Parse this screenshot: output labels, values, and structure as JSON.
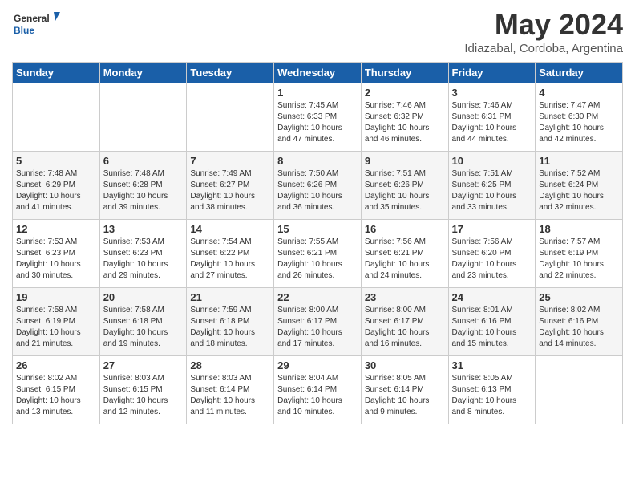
{
  "header": {
    "logo_general": "General",
    "logo_blue": "Blue",
    "title": "May 2024",
    "location": "Idiazabal, Cordoba, Argentina"
  },
  "days_of_week": [
    "Sunday",
    "Monday",
    "Tuesday",
    "Wednesday",
    "Thursday",
    "Friday",
    "Saturday"
  ],
  "weeks": [
    [
      {
        "day": "",
        "info": ""
      },
      {
        "day": "",
        "info": ""
      },
      {
        "day": "",
        "info": ""
      },
      {
        "day": "1",
        "info": "Sunrise: 7:45 AM\nSunset: 6:33 PM\nDaylight: 10 hours\nand 47 minutes."
      },
      {
        "day": "2",
        "info": "Sunrise: 7:46 AM\nSunset: 6:32 PM\nDaylight: 10 hours\nand 46 minutes."
      },
      {
        "day": "3",
        "info": "Sunrise: 7:46 AM\nSunset: 6:31 PM\nDaylight: 10 hours\nand 44 minutes."
      },
      {
        "day": "4",
        "info": "Sunrise: 7:47 AM\nSunset: 6:30 PM\nDaylight: 10 hours\nand 42 minutes."
      }
    ],
    [
      {
        "day": "5",
        "info": "Sunrise: 7:48 AM\nSunset: 6:29 PM\nDaylight: 10 hours\nand 41 minutes."
      },
      {
        "day": "6",
        "info": "Sunrise: 7:48 AM\nSunset: 6:28 PM\nDaylight: 10 hours\nand 39 minutes."
      },
      {
        "day": "7",
        "info": "Sunrise: 7:49 AM\nSunset: 6:27 PM\nDaylight: 10 hours\nand 38 minutes."
      },
      {
        "day": "8",
        "info": "Sunrise: 7:50 AM\nSunset: 6:26 PM\nDaylight: 10 hours\nand 36 minutes."
      },
      {
        "day": "9",
        "info": "Sunrise: 7:51 AM\nSunset: 6:26 PM\nDaylight: 10 hours\nand 35 minutes."
      },
      {
        "day": "10",
        "info": "Sunrise: 7:51 AM\nSunset: 6:25 PM\nDaylight: 10 hours\nand 33 minutes."
      },
      {
        "day": "11",
        "info": "Sunrise: 7:52 AM\nSunset: 6:24 PM\nDaylight: 10 hours\nand 32 minutes."
      }
    ],
    [
      {
        "day": "12",
        "info": "Sunrise: 7:53 AM\nSunset: 6:23 PM\nDaylight: 10 hours\nand 30 minutes."
      },
      {
        "day": "13",
        "info": "Sunrise: 7:53 AM\nSunset: 6:23 PM\nDaylight: 10 hours\nand 29 minutes."
      },
      {
        "day": "14",
        "info": "Sunrise: 7:54 AM\nSunset: 6:22 PM\nDaylight: 10 hours\nand 27 minutes."
      },
      {
        "day": "15",
        "info": "Sunrise: 7:55 AM\nSunset: 6:21 PM\nDaylight: 10 hours\nand 26 minutes."
      },
      {
        "day": "16",
        "info": "Sunrise: 7:56 AM\nSunset: 6:21 PM\nDaylight: 10 hours\nand 24 minutes."
      },
      {
        "day": "17",
        "info": "Sunrise: 7:56 AM\nSunset: 6:20 PM\nDaylight: 10 hours\nand 23 minutes."
      },
      {
        "day": "18",
        "info": "Sunrise: 7:57 AM\nSunset: 6:19 PM\nDaylight: 10 hours\nand 22 minutes."
      }
    ],
    [
      {
        "day": "19",
        "info": "Sunrise: 7:58 AM\nSunset: 6:19 PM\nDaylight: 10 hours\nand 21 minutes."
      },
      {
        "day": "20",
        "info": "Sunrise: 7:58 AM\nSunset: 6:18 PM\nDaylight: 10 hours\nand 19 minutes."
      },
      {
        "day": "21",
        "info": "Sunrise: 7:59 AM\nSunset: 6:18 PM\nDaylight: 10 hours\nand 18 minutes."
      },
      {
        "day": "22",
        "info": "Sunrise: 8:00 AM\nSunset: 6:17 PM\nDaylight: 10 hours\nand 17 minutes."
      },
      {
        "day": "23",
        "info": "Sunrise: 8:00 AM\nSunset: 6:17 PM\nDaylight: 10 hours\nand 16 minutes."
      },
      {
        "day": "24",
        "info": "Sunrise: 8:01 AM\nSunset: 6:16 PM\nDaylight: 10 hours\nand 15 minutes."
      },
      {
        "day": "25",
        "info": "Sunrise: 8:02 AM\nSunset: 6:16 PM\nDaylight: 10 hours\nand 14 minutes."
      }
    ],
    [
      {
        "day": "26",
        "info": "Sunrise: 8:02 AM\nSunset: 6:15 PM\nDaylight: 10 hours\nand 13 minutes."
      },
      {
        "day": "27",
        "info": "Sunrise: 8:03 AM\nSunset: 6:15 PM\nDaylight: 10 hours\nand 12 minutes."
      },
      {
        "day": "28",
        "info": "Sunrise: 8:03 AM\nSunset: 6:14 PM\nDaylight: 10 hours\nand 11 minutes."
      },
      {
        "day": "29",
        "info": "Sunrise: 8:04 AM\nSunset: 6:14 PM\nDaylight: 10 hours\nand 10 minutes."
      },
      {
        "day": "30",
        "info": "Sunrise: 8:05 AM\nSunset: 6:14 PM\nDaylight: 10 hours\nand 9 minutes."
      },
      {
        "day": "31",
        "info": "Sunrise: 8:05 AM\nSunset: 6:13 PM\nDaylight: 10 hours\nand 8 minutes."
      },
      {
        "day": "",
        "info": ""
      }
    ]
  ]
}
